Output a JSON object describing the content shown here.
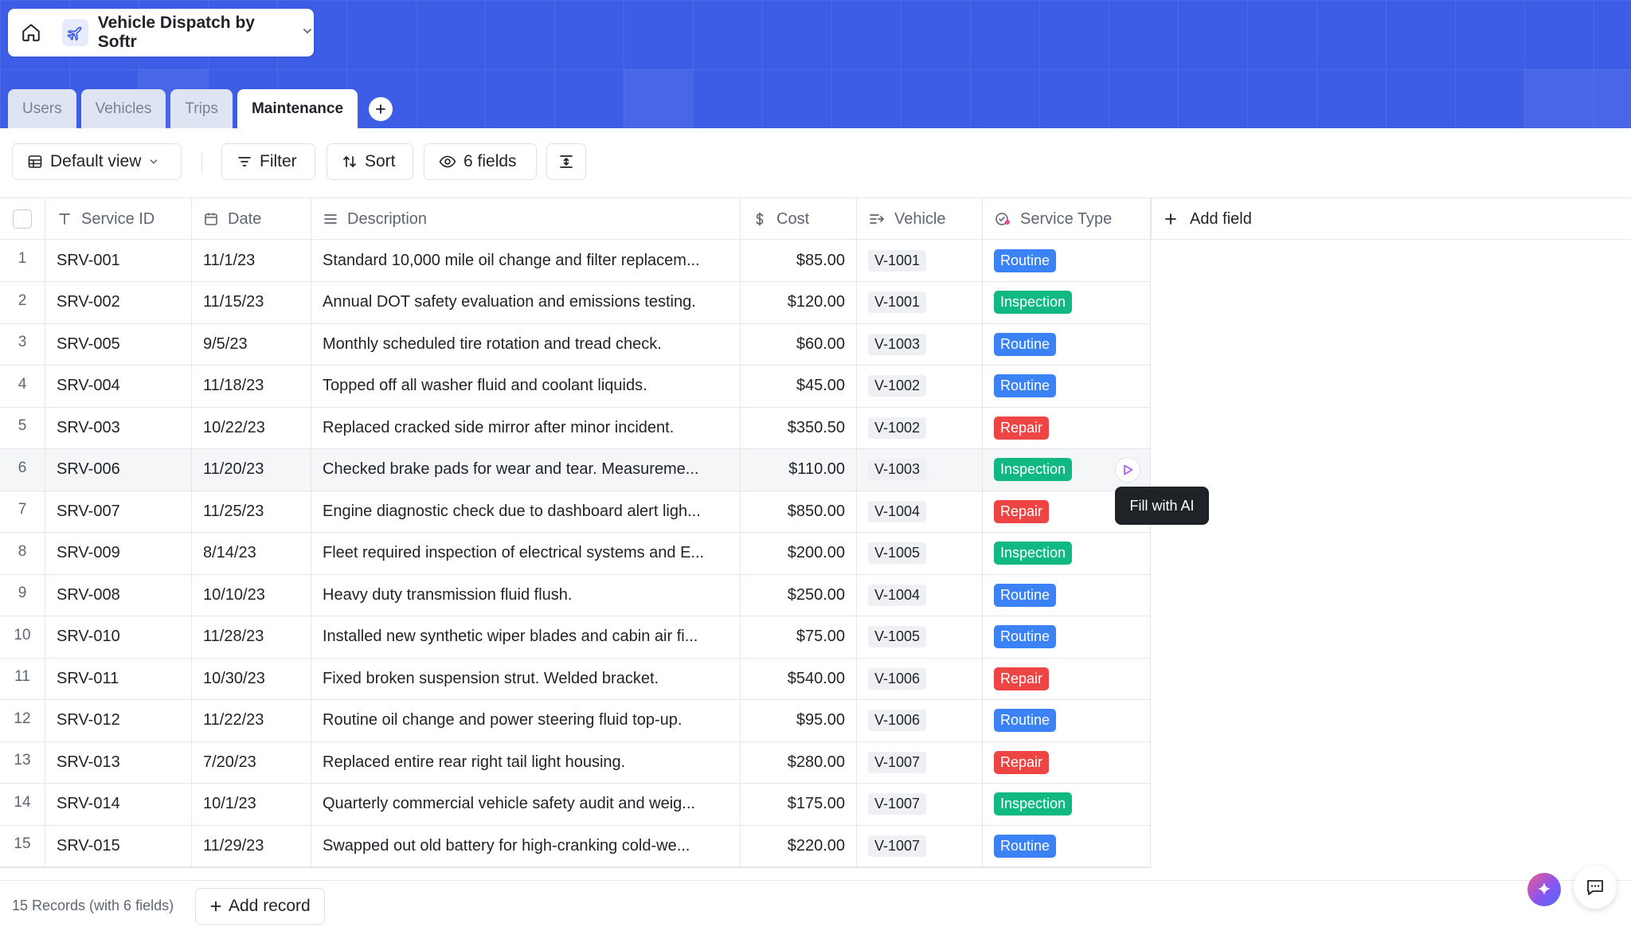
{
  "app": {
    "title": "Vehicle Dispatch by Softr"
  },
  "tabs": [
    {
      "label": "Users",
      "active": false
    },
    {
      "label": "Vehicles",
      "active": false
    },
    {
      "label": "Trips",
      "active": false
    },
    {
      "label": "Maintenance",
      "active": true
    }
  ],
  "toolbar": {
    "view_label": "Default view",
    "filter_label": "Filter",
    "sort_label": "Sort",
    "fields_label": "6 fields"
  },
  "columns": [
    {
      "label": "Service ID",
      "icon": "text-type-icon"
    },
    {
      "label": "Date",
      "icon": "calendar-icon"
    },
    {
      "label": "Description",
      "icon": "long-text-icon"
    },
    {
      "label": "Cost",
      "icon": "dollar-icon"
    },
    {
      "label": "Vehicle",
      "icon": "link-icon"
    },
    {
      "label": "Service Type",
      "icon": "select-icon"
    }
  ],
  "add_field_label": "Add field",
  "badge_colors": {
    "Routine": "#3b82f6",
    "Inspection": "#10b981",
    "Repair": "#ef4444"
  },
  "rows": [
    {
      "num": "1",
      "id": "SRV-001",
      "date": "11/1/23",
      "desc": "Standard 10,000 mile oil change and filter replacem...",
      "cost": "$85.00",
      "vehicle": "V-1001",
      "type": "Routine"
    },
    {
      "num": "2",
      "id": "SRV-002",
      "date": "11/15/23",
      "desc": "Annual DOT safety evaluation and emissions testing.",
      "cost": "$120.00",
      "vehicle": "V-1001",
      "type": "Inspection"
    },
    {
      "num": "3",
      "id": "SRV-005",
      "date": "9/5/23",
      "desc": "Monthly scheduled tire rotation and tread check.",
      "cost": "$60.00",
      "vehicle": "V-1003",
      "type": "Routine"
    },
    {
      "num": "4",
      "id": "SRV-004",
      "date": "11/18/23",
      "desc": "Topped off all washer fluid and coolant liquids.",
      "cost": "$45.00",
      "vehicle": "V-1002",
      "type": "Routine"
    },
    {
      "num": "5",
      "id": "SRV-003",
      "date": "10/22/23",
      "desc": "Replaced cracked side mirror after minor incident.",
      "cost": "$350.50",
      "vehicle": "V-1002",
      "type": "Repair"
    },
    {
      "num": "6",
      "id": "SRV-006",
      "date": "11/20/23",
      "desc": "Checked brake pads for wear and tear. Measureme...",
      "cost": "$110.00",
      "vehicle": "V-1003",
      "type": "Inspection"
    },
    {
      "num": "7",
      "id": "SRV-007",
      "date": "11/25/23",
      "desc": "Engine diagnostic check due to dashboard alert ligh...",
      "cost": "$850.00",
      "vehicle": "V-1004",
      "type": "Repair"
    },
    {
      "num": "8",
      "id": "SRV-009",
      "date": "8/14/23",
      "desc": "Fleet required inspection of electrical systems and E...",
      "cost": "$200.00",
      "vehicle": "V-1005",
      "type": "Inspection"
    },
    {
      "num": "9",
      "id": "SRV-008",
      "date": "10/10/23",
      "desc": "Heavy duty transmission fluid flush.",
      "cost": "$250.00",
      "vehicle": "V-1004",
      "type": "Routine"
    },
    {
      "num": "10",
      "id": "SRV-010",
      "date": "11/28/23",
      "desc": "Installed new synthetic wiper blades and cabin air fi...",
      "cost": "$75.00",
      "vehicle": "V-1005",
      "type": "Routine"
    },
    {
      "num": "11",
      "id": "SRV-011",
      "date": "10/30/23",
      "desc": "Fixed broken suspension strut. Welded bracket.",
      "cost": "$540.00",
      "vehicle": "V-1006",
      "type": "Repair"
    },
    {
      "num": "12",
      "id": "SRV-012",
      "date": "11/22/23",
      "desc": "Routine oil change and power steering fluid top-up.",
      "cost": "$95.00",
      "vehicle": "V-1006",
      "type": "Routine"
    },
    {
      "num": "13",
      "id": "SRV-013",
      "date": "7/20/23",
      "desc": "Replaced entire rear right tail light housing.",
      "cost": "$280.00",
      "vehicle": "V-1007",
      "type": "Repair"
    },
    {
      "num": "14",
      "id": "SRV-014",
      "date": "10/1/23",
      "desc": "Quarterly commercial vehicle safety audit and weig...",
      "cost": "$175.00",
      "vehicle": "V-1007",
      "type": "Inspection"
    },
    {
      "num": "15",
      "id": "SRV-015",
      "date": "11/29/23",
      "desc": "Swapped out old battery for high-cranking cold-we...",
      "cost": "$220.00",
      "vehicle": "V-1007",
      "type": "Routine"
    }
  ],
  "tooltip": "Fill with AI",
  "footer": {
    "record_count": "15 Records (with 6 fields)",
    "add_record_label": "Add record"
  }
}
